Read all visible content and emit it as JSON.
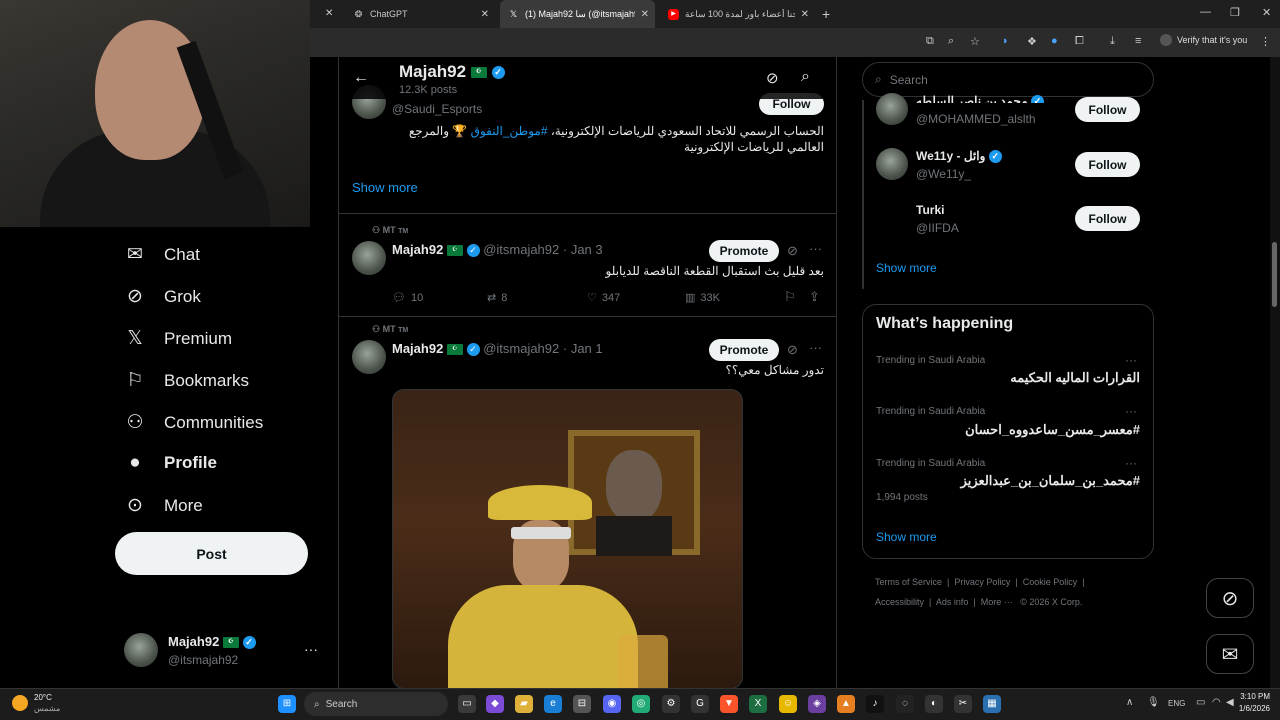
{
  "browser": {
    "tabs": [
      {
        "label": "ChatGPT",
        "active": false
      },
      {
        "label": "(1) Majah92 سا (@itsmajah92) /",
        "active": true
      },
      {
        "label": "سجنا أعضاء باور لمدة 100 ساعة",
        "active": false
      }
    ],
    "verify_label": "Verify that it's you"
  },
  "nav": {
    "items": [
      {
        "label": "Chat",
        "icon": "mail-icon"
      },
      {
        "label": "Grok",
        "icon": "grok-icon"
      },
      {
        "label": "Premium",
        "icon": "x-logo-icon"
      },
      {
        "label": "Bookmarks",
        "icon": "bookmark-icon"
      },
      {
        "label": "Communities",
        "icon": "communities-icon"
      },
      {
        "label": "Profile",
        "icon": "profile-icon"
      },
      {
        "label": "More",
        "icon": "more-circle-icon"
      }
    ],
    "post_label": "Post",
    "account": {
      "name": "Majah92",
      "handle": "@itsmajah92",
      "more": "···"
    }
  },
  "header": {
    "name": "Majah92",
    "posts": "12.3K posts"
  },
  "bio_card": {
    "handle": "@Saudi_Esports",
    "follow": "Follow",
    "line1_text": "الحساب الرسمي للاتحاد السعودي للرياضات الإلكترونية،",
    "line1_tag": "#موطن_النفوق",
    "line1_end": "والمرجع",
    "line2": "العالمي للرياضات الإلكترونية",
    "show_more": "Show more"
  },
  "posts": [
    {
      "context": "MT",
      "context_tm": "TM",
      "name": "Majah92",
      "handle": "@itsmajah92",
      "date": "· Jan 3",
      "promote": "Promote",
      "text": "بعد قليل بث استقبال القطعة الناقصة للديابلو",
      "replies": "10",
      "reposts": "8",
      "likes": "347",
      "views": "33K"
    },
    {
      "context": "MT",
      "context_tm": "TM",
      "name": "Majah92",
      "handle": "@itsmajah92",
      "date": "· Jan 1",
      "promote": "Promote",
      "text": "تدور مشاكل معي؟؟"
    }
  ],
  "right": {
    "search_placeholder": "Search",
    "who_to_follow": [
      {
        "name": "محمد بن ناصر السلطه",
        "handle": "@MOHAMMED_alslth",
        "follow": "Follow"
      },
      {
        "name": "We11y - وائل",
        "handle": "@We11y_",
        "follow": "Follow"
      },
      {
        "name": "Turki",
        "handle": "@IIFDA",
        "follow": "Follow"
      }
    ],
    "show_more": "Show more",
    "whats_happening": "What’s happening",
    "trends": [
      {
        "context": "Trending in Saudi Arabia",
        "title": "القرارات الماليه الحكيمه",
        "posts": ""
      },
      {
        "context": "Trending in Saudi Arabia",
        "title": "#معسر_مسن_ساعدووه_احسان",
        "posts": ""
      },
      {
        "context": "Trending in Saudi Arabia",
        "title": "#محمد_بن_سلمان_بن_عبدالعزيز",
        "posts": "1,994 posts"
      }
    ],
    "trends_show_more": "Show more",
    "footer": {
      "terms": "Terms of Service",
      "privacy": "Privacy Policy",
      "cookie": "Cookie Policy",
      "accessibility": "Accessibility",
      "ads": "Ads info",
      "more": "More ···",
      "copyright": "© 2026 X Corp."
    }
  },
  "taskbar": {
    "weather_temp": "20°C",
    "weather_desc": "مشمس",
    "search": "Search",
    "lang": "ENG",
    "time": "3:10 PM",
    "date": "1/6/2026"
  },
  "colors": {
    "accent": "#1d9bf0",
    "bg": "#000000",
    "border": "#2f3336",
    "muted": "#71767b"
  }
}
